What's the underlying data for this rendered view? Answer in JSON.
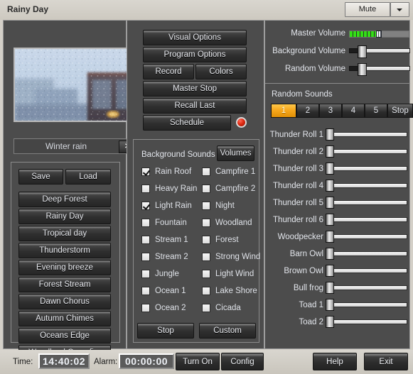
{
  "window": {
    "title": "Rainy Day",
    "mute_label": "Mute",
    "dropdown_icon": "chevron-down-icon"
  },
  "preview": {
    "caption": "Winter rain",
    "next_label": ">>",
    "image_alt": "rain-on-window-photo"
  },
  "actions": {
    "visual_options": "Visual Options",
    "program_options": "Program Options",
    "record": "Record",
    "colors": "Colors",
    "master_stop": "Master Stop",
    "recall_last": "Recall Last",
    "schedule": "Schedule",
    "schedule_led": "red"
  },
  "presets": {
    "save": "Save",
    "load": "Load",
    "items": [
      "Deep Forest",
      "Rainy Day",
      "Tropical day",
      "Thunderstorm",
      "Evening breeze",
      "Forest Stream",
      "Dawn Chorus",
      "Autumn Chimes",
      "Oceans Edge",
      "Woodland Campfire"
    ]
  },
  "background_sounds": {
    "title": "Background Sounds",
    "volumes_label": "Volumes",
    "stop_label": "Stop",
    "custom_label": "Custom",
    "left_column": [
      {
        "label": "Rain Roof",
        "checked": true
      },
      {
        "label": "Heavy Rain",
        "checked": false
      },
      {
        "label": "Light Rain",
        "checked": true
      },
      {
        "label": "Fountain",
        "checked": false
      },
      {
        "label": "Stream 1",
        "checked": false
      },
      {
        "label": "Stream 2",
        "checked": false
      },
      {
        "label": "Jungle",
        "checked": false
      },
      {
        "label": "Ocean 1",
        "checked": false
      },
      {
        "label": "Ocean 2",
        "checked": false
      }
    ],
    "right_column": [
      {
        "label": "Campfire 1",
        "checked": false
      },
      {
        "label": "Campfire 2",
        "checked": false
      },
      {
        "label": "Night",
        "checked": false
      },
      {
        "label": "Woodland",
        "checked": false
      },
      {
        "label": "Forest",
        "checked": false
      },
      {
        "label": "Strong Wind",
        "checked": false
      },
      {
        "label": "Light Wind",
        "checked": false
      },
      {
        "label": "Lake Shore",
        "checked": false
      },
      {
        "label": "Cicada",
        "checked": false
      }
    ]
  },
  "volumes": {
    "master": {
      "label": "Master Volume",
      "value": 38,
      "segments": 9
    },
    "background": {
      "label": "Background Volume",
      "value": 15
    },
    "random": {
      "label": "Random Volume",
      "value": 15
    }
  },
  "random_sounds": {
    "title": "Random Sounds",
    "tabs": [
      "1",
      "2",
      "3",
      "4",
      "5"
    ],
    "stop_label": "Stop",
    "active_tab": "1",
    "sliders": [
      {
        "label": "Thunder Roll 1",
        "value": 0
      },
      {
        "label": "Thunder roll 2",
        "value": 0
      },
      {
        "label": "Thunder roll 3",
        "value": 0
      },
      {
        "label": "Thunder roll 4",
        "value": 0
      },
      {
        "label": "Thunder roll 5",
        "value": 0
      },
      {
        "label": "Thunder roll 6",
        "value": 0
      },
      {
        "label": "Woodpecker",
        "value": 0
      },
      {
        "label": "Barn Owl",
        "value": 0
      },
      {
        "label": "Brown Owl",
        "value": 0
      },
      {
        "label": "Bull frog",
        "value": 0
      },
      {
        "label": "Toad 1",
        "value": 0
      },
      {
        "label": "Toad 2",
        "value": 0
      }
    ]
  },
  "statusbar": {
    "time_label": "Time:",
    "time_value": "14:40:02",
    "alarm_label": "Alarm:",
    "alarm_value": "00:00:00",
    "turn_on": "Turn On",
    "config": "Config",
    "help": "Help",
    "exit": "Exit"
  },
  "colors": {
    "accent_orange": "#f7a81d",
    "meter_green": "#33e016",
    "led_red": "#e02a12",
    "panel_bg": "#4c4c4c",
    "chrome_bg": "#d4d0c8"
  }
}
